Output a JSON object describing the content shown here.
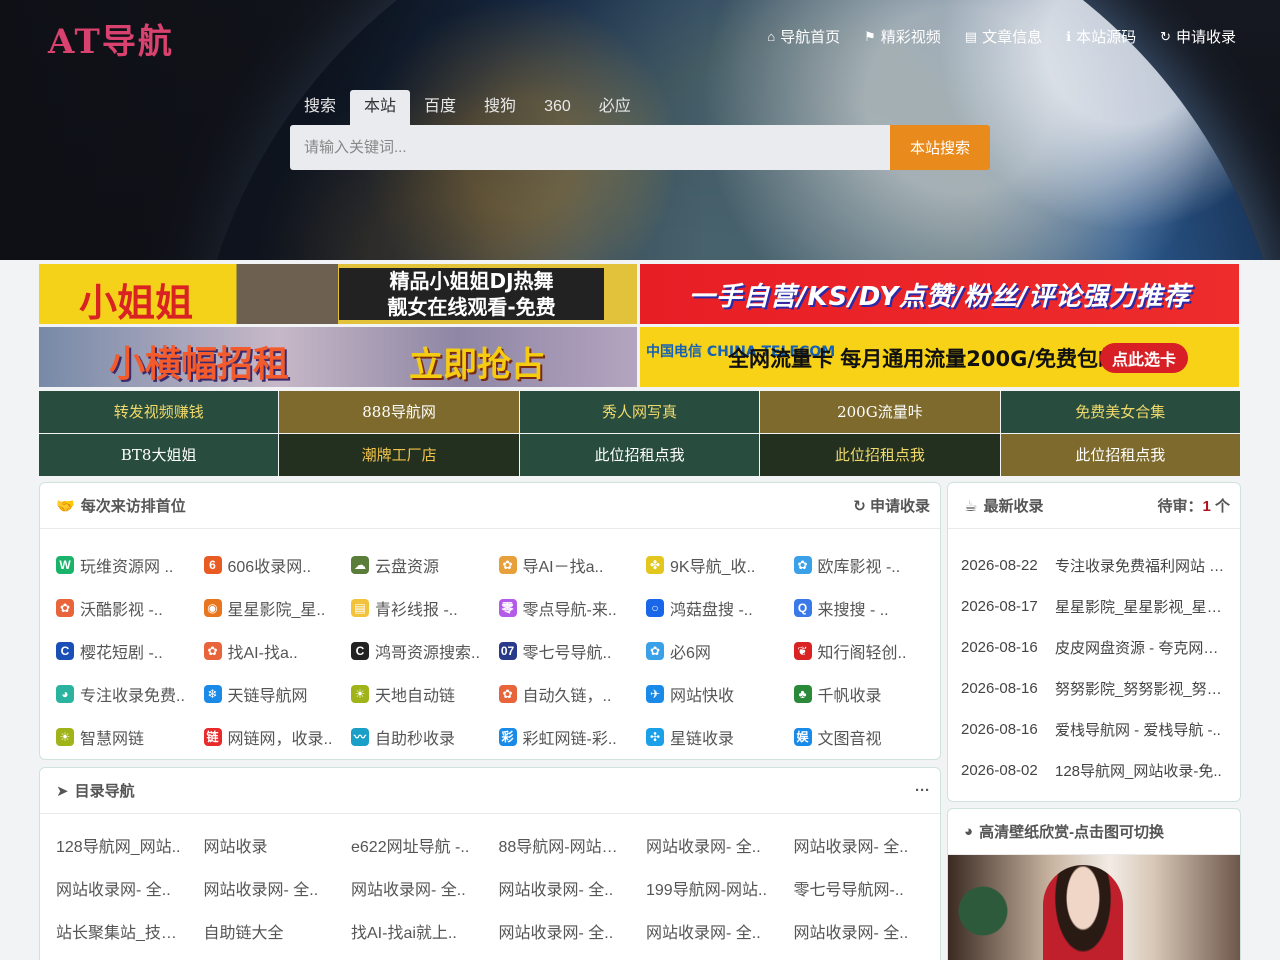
{
  "logo": "AT导航",
  "topnav": [
    {
      "icon": "home-icon",
      "glyph": "⌂",
      "label": "导航首页"
    },
    {
      "icon": "flag-icon",
      "glyph": "⚑",
      "label": "精彩视频"
    },
    {
      "icon": "book-icon",
      "glyph": "▤",
      "label": "文章信息"
    },
    {
      "icon": "info-icon",
      "glyph": "ℹ",
      "label": "本站源码"
    },
    {
      "icon": "refresh-icon",
      "glyph": "↻",
      "label": "申请收录"
    }
  ],
  "search": {
    "tabs": [
      "搜索",
      "本站",
      "百度",
      "搜狗",
      "360",
      "必应"
    ],
    "active_tab": "本站",
    "placeholder": "请输入关键词...",
    "button": "本站搜索"
  },
  "banners": {
    "b1": {
      "t1": "小姐姐",
      "t2a": "精品小姐姐DJ热舞",
      "t2b": "靓女在线观看-免费"
    },
    "b2": {
      "t1": "一手自营/KS/DY点赞/粉丝/评论强力推荐"
    },
    "b3": {
      "t1": "小横幅招租",
      "t2": "立即抢占"
    },
    "b4": {
      "logo": "中国电信 CHINA TELECOM",
      "t1": "全网流量卡 每月通用流量200G/免费包邮",
      "t2": "点此选卡"
    }
  },
  "links": [
    {
      "label": "转发视频赚钱",
      "bg": "#284d3e",
      "fg": "#f0d96a"
    },
    {
      "label": "888导航网",
      "bg": "#7d6a2c",
      "fg": "#ffffff"
    },
    {
      "label": "秀人网写真",
      "bg": "#284d3e",
      "fg": "#f0d96a"
    },
    {
      "label": "200G流量咔",
      "bg": "#7d6a2c",
      "fg": "#ffffff"
    },
    {
      "label": "免费美女合集",
      "bg": "#284d3e",
      "fg": "#f0d96a"
    },
    {
      "label": "BT8大姐姐",
      "bg": "#284d3e",
      "fg": "#ffffff"
    },
    {
      "label": "潮牌工厂店",
      "bg": "#23301f",
      "fg": "#f0c24a"
    },
    {
      "label": "此位招租点我",
      "bg": "#284d3e",
      "fg": "#ffffff"
    },
    {
      "label": "此位招租点我",
      "bg": "#23301f",
      "fg": "#f0d96a"
    },
    {
      "label": "此位招租点我",
      "bg": "#7d6a2c",
      "fg": "#ffffff"
    }
  ],
  "visit_panel": {
    "title": "每次来访排首位",
    "action": "申请收录",
    "sites": [
      {
        "name": "玩维资源网 ..",
        "icon": "w-icon",
        "glyph": "W",
        "color": "#19b46a"
      },
      {
        "name": "606收录网..",
        "icon": "six-icon",
        "glyph": "6",
        "color": "#e85b22"
      },
      {
        "name": "云盘资源",
        "icon": "cloud-icon",
        "glyph": "☁",
        "color": "#5a7d3a"
      },
      {
        "name": "导AI－找a..",
        "icon": "pinwheel-icon",
        "glyph": "✿",
        "color": "#e8a13a"
      },
      {
        "name": "9K导航_收..",
        "icon": "clover-icon",
        "glyph": "✤",
        "color": "#e3c61e"
      },
      {
        "name": "欧库影视 -..",
        "icon": "pinwheel-icon",
        "glyph": "✿",
        "color": "#3aa0e8"
      },
      {
        "name": "沃酷影视 -..",
        "icon": "pinwheel-icon",
        "glyph": "✿",
        "color": "#e8643a"
      },
      {
        "name": "星星影院_星..",
        "icon": "rss-icon",
        "glyph": "◉",
        "color": "#e8761e"
      },
      {
        "name": "青衫线报 -..",
        "icon": "note-icon",
        "glyph": "▤",
        "color": "#f2c23a"
      },
      {
        "name": "零点导航-来..",
        "icon": "zero-icon",
        "glyph": "零",
        "color": "#b45ae8"
      },
      {
        "name": "鸿菇盘搜 -..",
        "icon": "circle-icon",
        "glyph": "○",
        "color": "#1a66e8"
      },
      {
        "name": "来搜搜 - ..",
        "icon": "search-icon",
        "glyph": "Q",
        "color": "#3a7ae8"
      },
      {
        "name": "樱花短剧 -..",
        "icon": "c-icon",
        "glyph": "C",
        "color": "#1a4fb8"
      },
      {
        "name": "找AI-找a..",
        "icon": "pinwheel-icon",
        "glyph": "✿",
        "color": "#e8643a"
      },
      {
        "name": "鸿哥资源搜索..",
        "icon": "cat-icon",
        "glyph": "C",
        "color": "#222222"
      },
      {
        "name": "零七号导航..",
        "icon": "seven-icon",
        "glyph": "07",
        "color": "#2a3a8a"
      },
      {
        "name": "必6网",
        "icon": "pinwheel-icon",
        "glyph": "✿",
        "color": "#3aa0e8"
      },
      {
        "name": "知行阁轻创..",
        "icon": "leaf-icon",
        "glyph": "❦",
        "color": "#d92222"
      },
      {
        "name": "专注收录免费..",
        "icon": "globe-icon",
        "glyph": "◕",
        "color": "#2ab4a0"
      },
      {
        "name": "天链导航网",
        "icon": "snowflake-icon",
        "glyph": "❄",
        "color": "#1a8ae8"
      },
      {
        "name": "天地自动链",
        "icon": "sun-icon",
        "glyph": "☀",
        "color": "#a0b41a"
      },
      {
        "name": "自动久链，..",
        "icon": "pinwheel-icon",
        "glyph": "✿",
        "color": "#e8643a"
      },
      {
        "name": "网站快收",
        "icon": "plane-icon",
        "glyph": "✈",
        "color": "#1a8ae8"
      },
      {
        "name": "千帆收录",
        "icon": "club-icon",
        "glyph": "♣",
        "color": "#2a8a3a"
      },
      {
        "name": "智慧网链",
        "icon": "sun-icon",
        "glyph": "☀",
        "color": "#a0b41a"
      },
      {
        "name": "网链网，收录..",
        "icon": "link-icon",
        "glyph": "链",
        "color": "#e82a2a"
      },
      {
        "name": "自助秒收录",
        "icon": "wave-icon",
        "glyph": "〰",
        "color": "#1aa0c8"
      },
      {
        "name": "彩虹网链-彩..",
        "icon": "rainbow-icon",
        "glyph": "彩",
        "color": "#1a8ae8"
      },
      {
        "name": "星链收录",
        "icon": "sparkle-icon",
        "glyph": "✣",
        "color": "#1aa0e8"
      },
      {
        "name": "文图音视",
        "icon": "media-icon",
        "glyph": "娱",
        "color": "#1a8ae8"
      }
    ]
  },
  "dir_panel": {
    "title": "目录导航",
    "more": "···",
    "items": [
      "128导航网_网站..",
      "网站收录",
      "e622网址导航 -..",
      "88导航网-网站收..",
      "网站收录网- 全..",
      "网站收录网- 全..",
      "网站收录网- 全..",
      "网站收录网- 全..",
      "网站收录网- 全..",
      "网站收录网- 全..",
      "199导航网-网站..",
      "零七号导航网-..",
      "站长聚集站_技术..",
      "自助链大全",
      "找AI-找ai就上..",
      "网站收录网- 全..",
      "网站收录网- 全..",
      "网站收录网- 全.."
    ]
  },
  "recent_panel": {
    "title": "最新收录",
    "pending_label": "待审：",
    "pending_count": "1",
    "pending_unit": " 个",
    "items": [
      {
        "date": "2026-08-22",
        "name": "专注收录免费福利网站 - .."
      },
      {
        "date": "2026-08-17",
        "name": "星星影院_星星影视_星星.."
      },
      {
        "date": "2026-08-16",
        "name": "皮皮网盘资源 - 夸克网盘.."
      },
      {
        "date": "2026-08-16",
        "name": "努努影院_努努影视_努努.."
      },
      {
        "date": "2026-08-16",
        "name": "爱栈导航网 - 爱栈导航 -.."
      },
      {
        "date": "2026-08-02",
        "name": "128导航网_网站收录-免.."
      }
    ]
  },
  "wallpaper_panel": {
    "title": "高清壁纸欣赏-点击图可切换"
  }
}
